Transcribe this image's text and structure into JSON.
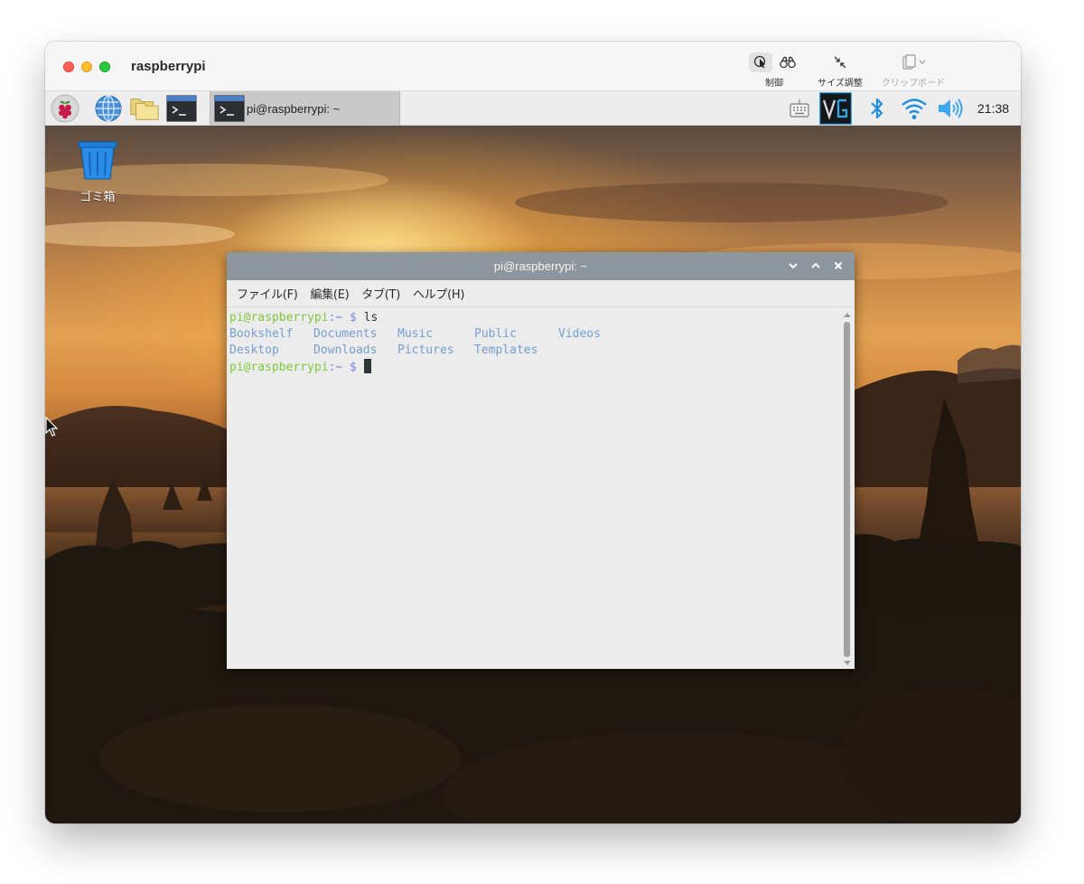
{
  "window": {
    "title": "raspberrypi"
  },
  "toolbar": {
    "control_label": "制御",
    "resize_label": "サイズ調整",
    "clipboard_label": "クリップボード"
  },
  "panel": {
    "launchers": [
      {
        "name": "raspberry-menu-icon"
      },
      {
        "name": "web-browser-icon"
      },
      {
        "name": "file-manager-icon"
      },
      {
        "name": "terminal-icon"
      }
    ],
    "task": {
      "label": "pi@raspberrypi: ~"
    },
    "tray": [
      "keyboard-icon",
      "vnc-icon",
      "bluetooth-icon",
      "wifi-icon",
      "volume-icon"
    ],
    "clock": "21:38"
  },
  "desktop": {
    "trash_label": "ゴミ箱"
  },
  "terminal": {
    "title": "pi@raspberrypi: ~",
    "menu": [
      "ファイル(F)",
      "編集(E)",
      "タブ(T)",
      "ヘルプ(H)"
    ],
    "prompt_user": "pi@raspberrypi",
    "prompt_suffix": ":~ $ ",
    "command": "ls",
    "listing": [
      [
        "Bookshelf",
        "Documents",
        "Music",
        "Public",
        "Videos"
      ],
      [
        "Desktop",
        "Downloads",
        "Pictures",
        "Templates"
      ]
    ]
  },
  "colors": {
    "terminal_prompt": "#7fc93a",
    "terminal_dir": "#729fcf",
    "terminal_titlebar": "#8e969d",
    "vnc_accent": "#3aa3e3",
    "tray_blue": "#1f8de2"
  }
}
